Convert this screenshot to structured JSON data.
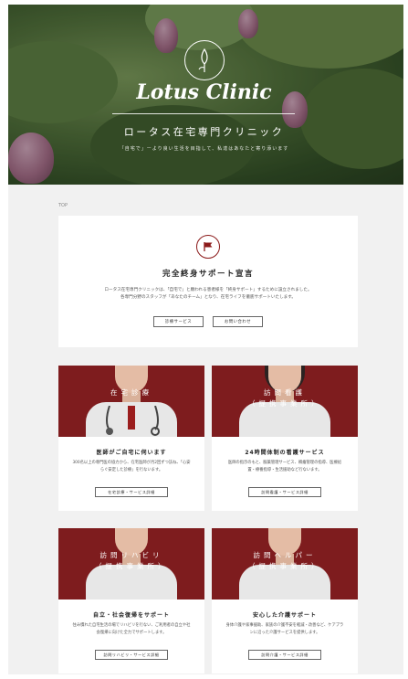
{
  "hero": {
    "brand": "Lotus Clinic",
    "subtitle": "ロータス在宅専門クリニック",
    "tagline": "「自宅で」ーより良い生活を目指して、私達はあなたと寄り添います"
  },
  "breadcrumb": "TOP",
  "declaration": {
    "icon": "flag-icon",
    "title": "完全終身サポート宣言",
    "text_line1": "ロータス在宅専門クリニックは、「自宅で」と願われる患者様を「終身サポート」するために設立されました。",
    "text_line2": "各専門分野のスタッフが「あなたのチーム」となり、在宅ライフを徹底サポートいたします。",
    "button_services": "診療サービス",
    "button_contact": "お問い合わせ"
  },
  "services": [
    {
      "image_label_1": "在宅診療",
      "image_label_2": "",
      "title": "医師がご自宅に伺います",
      "text": "300名以上の専門医の協力から、在宅医師が月2回ずつ訪ね、「心安らぐ安定した診療」を行ないます。",
      "button": "在宅診療・サービス詳細"
    },
    {
      "image_label_1": "訪問看護",
      "image_label_2": "（提携事業所）",
      "title": "24時間体制の看護サービス",
      "text": "医師の指示のもと、服薬管理サービス、褥瘡管理の指導、医療処置・療養指導・生活援助など行ないます。",
      "button": "訪問看護・サービス詳細"
    },
    {
      "image_label_1": "訪問リハビリ",
      "image_label_2": "（提携事業所）",
      "title": "自立・社会復帰をサポート",
      "text": "住み慣れた自宅生活の場でリハビリを行ない、ご利用者の自立や社会復帰に向けた全力でサポートします。",
      "button": "訪問リハビリ・サービス詳細"
    },
    {
      "image_label_1": "訪問ヘルパー",
      "image_label_2": "（提携事業所）",
      "title": "安心した介護サポート",
      "text": "身体介護や家事援助、家族の介護不安を軽減・改善など、ケアプランに沿った介護サービスを提供します。",
      "button": "訪問介護・サービス詳細"
    }
  ],
  "colors": {
    "accent": "#7e1c1e",
    "background": "#f1f1f1"
  }
}
